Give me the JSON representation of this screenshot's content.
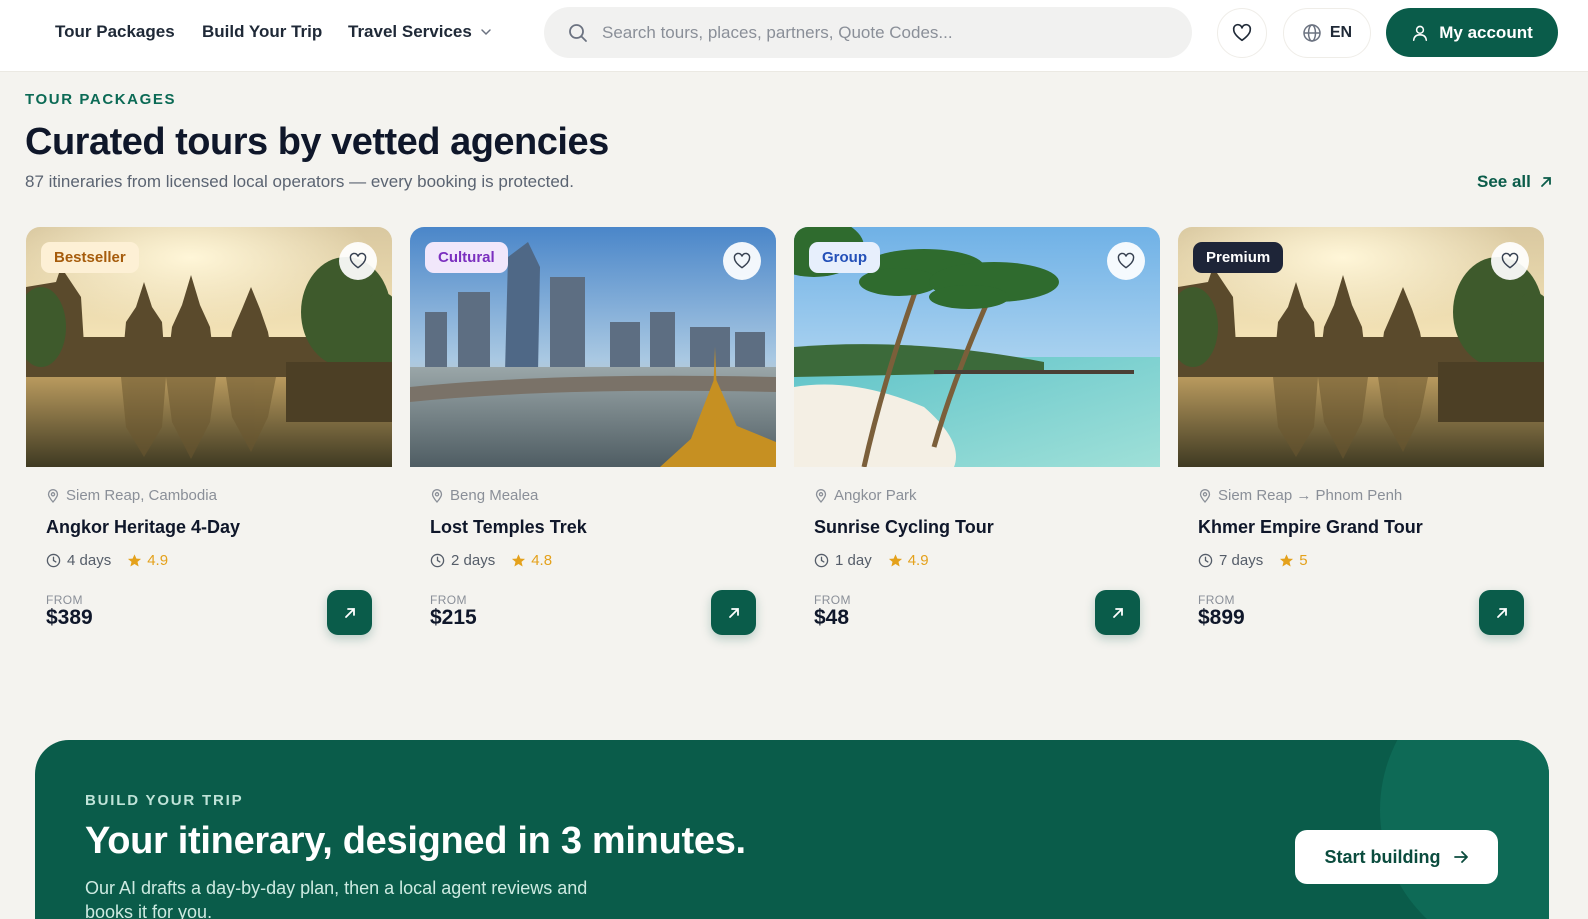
{
  "nav": {
    "items": [
      {
        "label": "Tour Packages"
      },
      {
        "label": "Build Your Trip"
      },
      {
        "label": "Travel Services"
      }
    ],
    "search_placeholder": "Search tours, places, partners, Quote Codes...",
    "language": "EN",
    "account_label": "My account"
  },
  "section": {
    "eyebrow": "TOUR PACKAGES",
    "title": "Curated tours by vetted agencies",
    "subtitle": "87 itineraries from licensed local operators — every booking is protected.",
    "see_all": "See all"
  },
  "price_prefix": "FROM",
  "tours": [
    {
      "badge": "Bestseller",
      "badge_bg": "#fdf0d5",
      "badge_color": "#a65c0c",
      "image": "temple-reflection",
      "location": "Siem Reap, Cambodia",
      "name": "Angkor Heritage 4-Day",
      "duration": "4 days",
      "rating": "4.9",
      "price": "$389"
    },
    {
      "badge": "Cultural",
      "badge_bg": "#f1e7fb",
      "badge_color": "#7b2fbf",
      "image": "city-skyline",
      "location": "Beng Mealea",
      "name": "Lost Temples Trek",
      "duration": "2 days",
      "rating": "4.8",
      "price": "$215"
    },
    {
      "badge": "Group",
      "badge_bg": "#e7effc",
      "badge_color": "#2350b8",
      "image": "tropical-beach",
      "location": "Angkor Park",
      "name": "Sunrise Cycling Tour",
      "duration": "1 day",
      "rating": "4.9",
      "price": "$48"
    },
    {
      "badge": "Premium",
      "badge_bg": "#1e2538",
      "badge_color": "#ffffff",
      "image": "temple-reflection",
      "location": "Siem Reap → Phnom Penh",
      "name": "Khmer Empire Grand Tour",
      "duration": "7 days",
      "rating": "5",
      "price": "$899"
    }
  ],
  "promo": {
    "eyebrow": "BUILD YOUR TRIP",
    "headline": "Your itinerary, designed in 3 minutes.",
    "description": "Our AI drafts a day-by-day plan, then a local agent reviews and books it for you.",
    "button": "Start building"
  },
  "colors": {
    "brand": "#0a5c4a",
    "star": "#e4a11b",
    "page_bg": "#f4f3ef"
  }
}
